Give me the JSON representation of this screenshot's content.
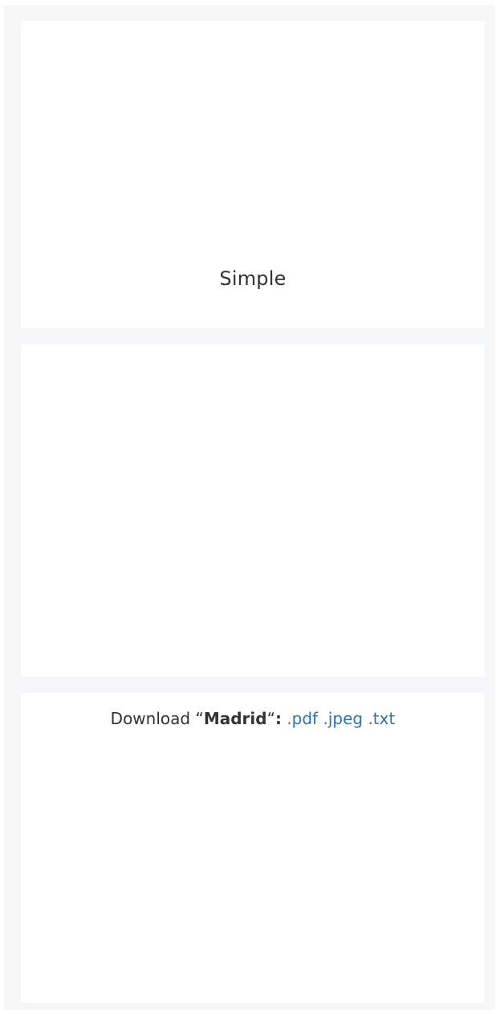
{
  "panels": {
    "first": {
      "caption": "Simple"
    },
    "download": {
      "prefix": "Download",
      "open_quote": "“",
      "name": "Madrid",
      "close_quote": "“",
      "colon": ":",
      "links": [
        ".pdf",
        ".jpeg",
        ".txt"
      ]
    }
  },
  "colors": {
    "frame_background": "#f5f6f8",
    "panel_background": "#ffffff",
    "text": "#333333",
    "link": "#2a73b4"
  }
}
